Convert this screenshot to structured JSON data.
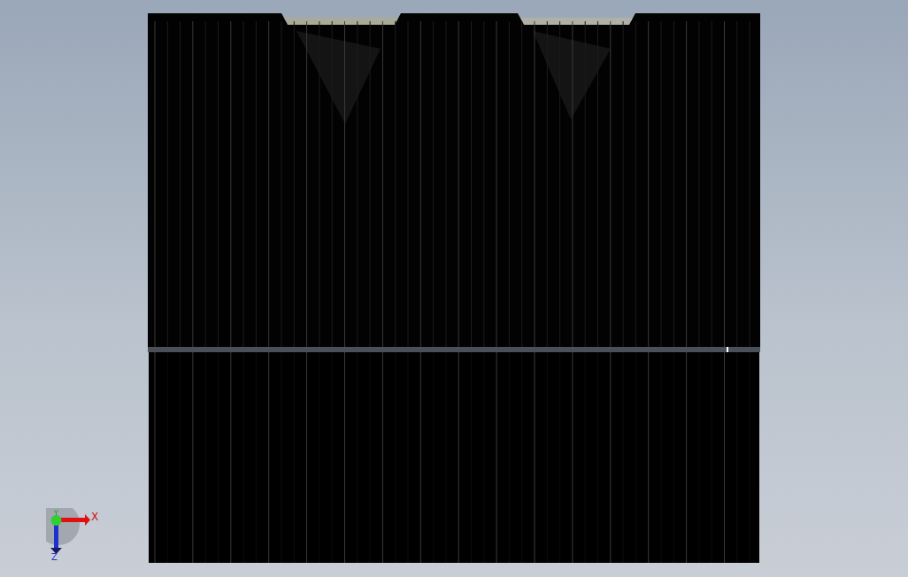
{
  "viewport": {
    "triad": {
      "x_label": "X",
      "y_label": "Y",
      "z_label": "Z"
    }
  }
}
